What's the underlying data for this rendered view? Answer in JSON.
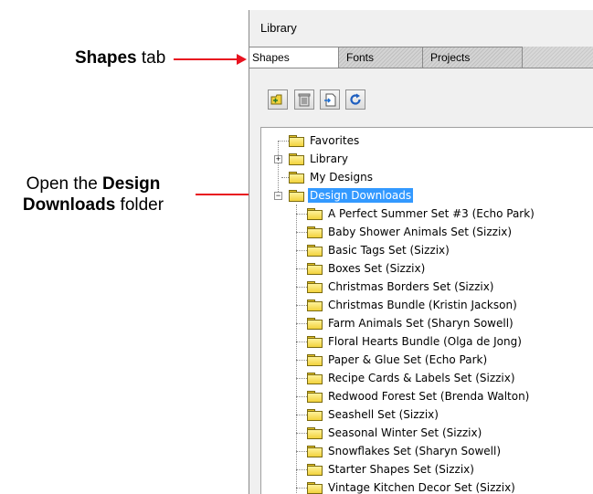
{
  "annotations": {
    "shapes_tab_bold": "Shapes",
    "shapes_tab_rest": " tab",
    "open_prefix": "Open the ",
    "open_bold_1": "Design",
    "open_bold_2": "Downloads",
    "open_suffix": " folder"
  },
  "colors": {
    "arrow": "#e8121f",
    "selection": "#3399ff",
    "folder": "#f2d23c"
  },
  "panel": {
    "title": "Library",
    "tabs": [
      {
        "label": "Shapes",
        "active": true
      },
      {
        "label": "Fonts",
        "active": false
      },
      {
        "label": "Projects",
        "active": false
      }
    ],
    "toolbar": [
      {
        "icon": "new-folder-icon"
      },
      {
        "icon": "trash-icon"
      },
      {
        "icon": "import-icon"
      },
      {
        "icon": "refresh-icon"
      }
    ],
    "tree": {
      "top_level": [
        {
          "label": "Favorites",
          "expander": ""
        },
        {
          "label": "Library",
          "expander": "+"
        },
        {
          "label": "My Designs",
          "expander": ""
        },
        {
          "label": "Design Downloads",
          "expander": "−",
          "selected": true
        }
      ],
      "children": [
        "A Perfect Summer Set #3 (Echo Park)",
        "Baby Shower Animals Set (Sizzix)",
        "Basic Tags Set (Sizzix)",
        "Boxes Set (Sizzix)",
        "Christmas Borders Set (Sizzix)",
        "Christmas Bundle (Kristin Jackson)",
        "Farm Animals Set (Sharyn Sowell)",
        "Floral Hearts Bundle (Olga de Jong)",
        "Paper & Glue Set (Echo Park)",
        "Recipe Cards & Labels Set (Sizzix)",
        "Redwood Forest Set (Brenda Walton)",
        "Seashell Set (Sizzix)",
        "Seasonal Winter Set (Sizzix)",
        "Snowflakes Set (Sharyn Sowell)",
        "Starter Shapes Set (Sizzix)",
        "Vintage Kitchen Decor Set (Sizzix)"
      ]
    }
  }
}
